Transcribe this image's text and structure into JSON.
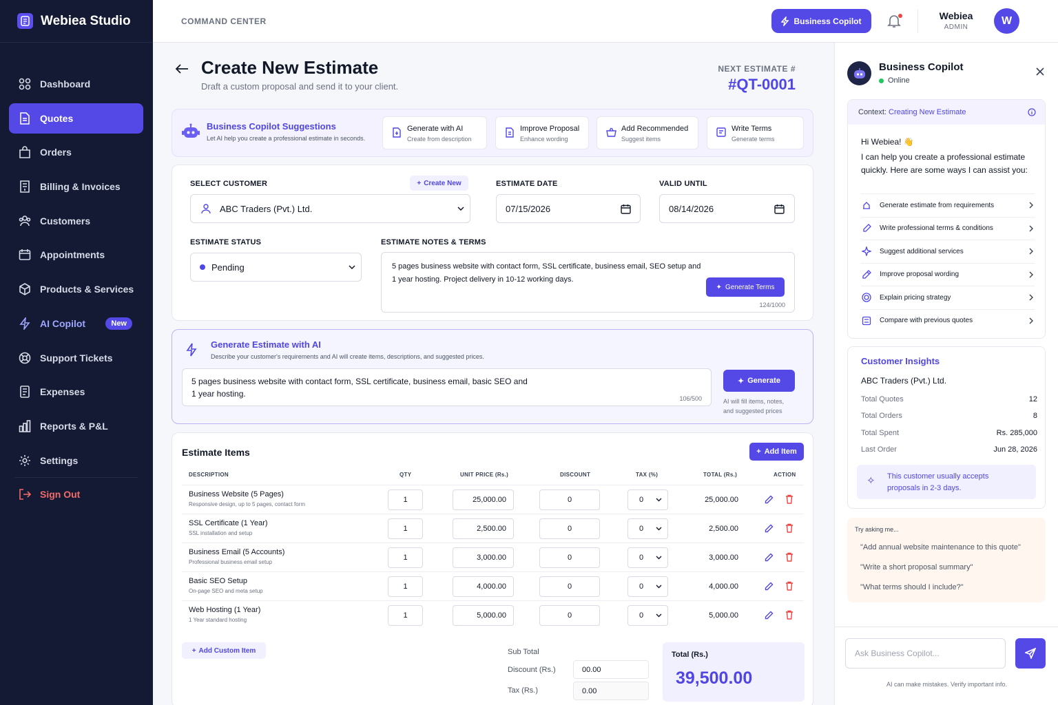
{
  "brand": {
    "name": "Webiea Studio"
  },
  "nav": [
    {
      "label": "Dashboard",
      "icon": "grid-icon"
    },
    {
      "label": "Quotes",
      "icon": "document-icon",
      "active": true
    },
    {
      "label": "Orders",
      "icon": "bag-icon"
    },
    {
      "label": "Billing & Invoices",
      "icon": "receipt-icon"
    },
    {
      "label": "Customers",
      "icon": "users-icon"
    },
    {
      "label": "Appointments",
      "icon": "calendar-icon"
    },
    {
      "label": "Products & Services",
      "icon": "box-icon"
    },
    {
      "label": "AI Copilot",
      "icon": "bolt-icon",
      "badge": "New"
    },
    {
      "label": "Support Tickets",
      "icon": "lifebuoy-icon"
    },
    {
      "label": "Expenses",
      "icon": "list-icon"
    },
    {
      "label": "Reports & P&L",
      "icon": "bar-chart-icon"
    },
    {
      "label": "Settings",
      "icon": "gear-icon"
    },
    {
      "label": "Sign Out",
      "icon": "logout-icon"
    }
  ],
  "topbar": {
    "section": "COMMAND CENTER",
    "copilot_button": "Business Copilot",
    "user_name": "Webiea",
    "user_role": "ADMIN",
    "avatar_initial": "W"
  },
  "page": {
    "title": "Create New Estimate",
    "subtitle": "Draft a custom proposal and send it to your client.",
    "next_label": "NEXT ESTIMATE #",
    "next_number": "#QT-0001"
  },
  "suggestions": {
    "title": "Business Copilot Suggestions",
    "subtitle": "Let AI help you create a professional estimate in seconds.",
    "chips": [
      {
        "title": "Generate with AI",
        "sub": "Create from description"
      },
      {
        "title": "Improve Proposal",
        "sub": "Enhance wording"
      },
      {
        "title": "Add Recommended",
        "sub": "Suggest items"
      },
      {
        "title": "Write Terms",
        "sub": "Generate terms"
      }
    ]
  },
  "form": {
    "customer_label": "SELECT CUSTOMER",
    "create_new": "Create New",
    "customer_value": "ABC Traders (Pvt.) Ltd.",
    "date_label": "ESTIMATE DATE",
    "date_value": "07/15/2026",
    "valid_label": "VALID UNTIL",
    "valid_value": "08/14/2026",
    "status_label": "ESTIMATE STATUS",
    "status_value": "Pending",
    "notes_label": "ESTIMATE NOTES & TERMS",
    "notes_line1": "5 pages business website with contact form, SSL certificate, business email, SEO setup and",
    "notes_line2": "1 year hosting. Project delivery in 10-12 working days.",
    "generate_terms": "Generate Terms",
    "notes_count": "124/1000"
  },
  "ai_generate": {
    "title": "Generate Estimate with AI",
    "subtitle": "Describe your customer's requirements and AI will create items, descriptions, and suggested prices.",
    "prompt_line1": "5 pages business website with contact form, SSL certificate, business email, basic SEO and",
    "prompt_line2": "1 year hosting.",
    "count": "106/500",
    "button": "Generate",
    "hint_line1": "AI will fill items, notes,",
    "hint_line2": "and suggested prices"
  },
  "items": {
    "title": "Estimate Items",
    "add_item": "Add Item",
    "headers": {
      "description": "DESCRIPTION",
      "qty": "QTY",
      "unit_price": "UNIT PRICE (Rs.)",
      "discount": "DISCOUNT",
      "tax": "TAX (%)",
      "total": "TOTAL (Rs.)",
      "action": "ACTION"
    },
    "rows": [
      {
        "name": "Business Website (5 Pages)",
        "desc": "Responsive design, up to 5 pages, contact form",
        "qty": "1",
        "price": "25,000.00",
        "discount": "0",
        "tax": "0",
        "total": "25,000.00"
      },
      {
        "name": "SSL Certificate (1 Year)",
        "desc": "SSL installation and setup",
        "qty": "1",
        "price": "2,500.00",
        "discount": "0",
        "tax": "0",
        "total": "2,500.00"
      },
      {
        "name": "Business Email (5 Accounts)",
        "desc": "Professional business email setup",
        "qty": "1",
        "price": "3,000.00",
        "discount": "0",
        "tax": "0",
        "total": "3,000.00"
      },
      {
        "name": "Basic SEO Setup",
        "desc": "On-page SEO and meta setup",
        "qty": "1",
        "price": "4,000.00",
        "discount": "0",
        "tax": "0",
        "total": "4,000.00"
      },
      {
        "name": "Web Hosting (1 Year)",
        "desc": "1 Year standard hosting",
        "qty": "1",
        "price": "5,000.00",
        "discount": "0",
        "tax": "0",
        "total": "5,000.00"
      }
    ],
    "add_custom": "Add Custom Item",
    "subtotal_label": "Sub Total",
    "discount_label": "Discount (Rs.)",
    "discount_value": "00.00",
    "tax_label": "Tax (Rs.)",
    "tax_value": "0.00",
    "total_label": "Total (Rs.)",
    "total_value": "39,500.00"
  },
  "panel": {
    "title": "Business Copilot",
    "status": "Online",
    "context_label": "Context:",
    "context_value": "Creating New Estimate",
    "greeting": "Hi Webiea! 👋",
    "intro": "I can help you create a professional estimate quickly. Here are some ways I can assist you:",
    "actions": [
      {
        "label": "Generate estimate from requirements",
        "icon": "magic-icon"
      },
      {
        "label": "Write professional terms & conditions",
        "icon": "pen-icon"
      },
      {
        "label": "Suggest additional services",
        "icon": "sparkle-icon"
      },
      {
        "label": "Improve proposal wording",
        "icon": "edit-icon"
      },
      {
        "label": "Explain pricing strategy",
        "icon": "target-icon"
      },
      {
        "label": "Compare with previous quotes",
        "icon": "compare-icon"
      }
    ],
    "insights": {
      "title": "Customer Insights",
      "customer": "ABC Traders (Pvt.) Ltd.",
      "rows": [
        {
          "label": "Total Quotes",
          "value": "12"
        },
        {
          "label": "Total Orders",
          "value": "8"
        },
        {
          "label": "Total Spent",
          "value": "Rs. 285,000"
        },
        {
          "label": "Last Order",
          "value": "Jun 28, 2026"
        }
      ],
      "tip_line1": "This customer usually accepts",
      "tip_line2": "proposals in 2-3 days."
    },
    "try": {
      "title": "Try asking me...",
      "questions": [
        "\"Add annual website maintenance to this quote\"",
        "\"Write a short proposal summary\"",
        "\"What terms should I include?\""
      ]
    },
    "ask_placeholder": "Ask Business Copilot...",
    "disclaimer": "AI can make mistakes. Verify important info."
  },
  "colors": {
    "accent": "#5448e6",
    "sidebar": "#141a33",
    "signout": "#f26b6b"
  }
}
